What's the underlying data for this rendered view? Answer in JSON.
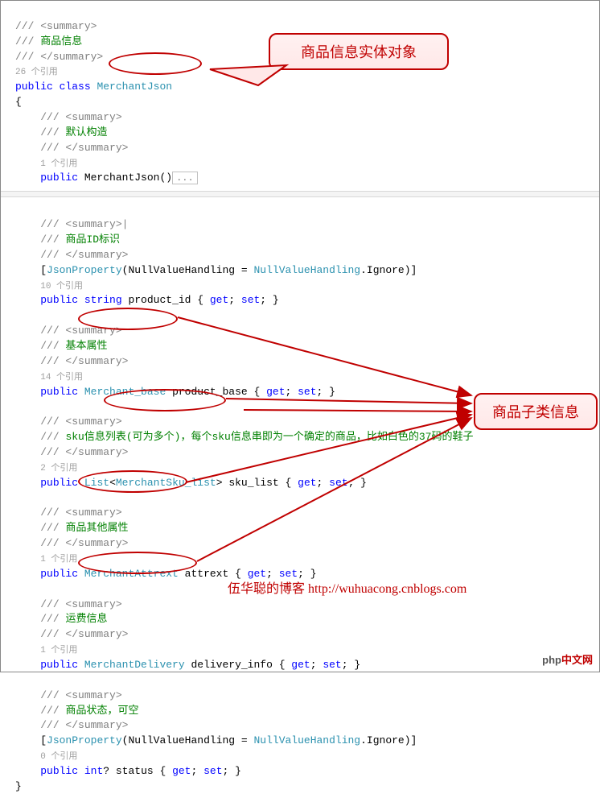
{
  "lines": {
    "l0": "/// <summary>",
    "l1": "/// 商品信息",
    "l2": "/// </summary>",
    "l3": "26 个引用",
    "l4_kw1": "public",
    "l4_kw2": "class",
    "l4_type": "MerchantJson",
    "l5": "{",
    "l6a": "/// <summary>",
    "l6b": "/// 默认构造",
    "l6c": "/// </summary>",
    "l6d": "1 个引用",
    "l7_kw": "public",
    "l7_name": " MerchantJson()",
    "l7_collapse": "...",
    "l8a": "/// <summary>|",
    "l8b": "/// 商品ID标识",
    "l8c": "/// </summary>",
    "l9a": "[",
    "l9b": "JsonProperty",
    "l9c": "(NullValueHandling = ",
    "l9d": "NullValueHandling",
    "l9e": ".Ignore)]",
    "l10": "10 个引用",
    "l11_kw1": "public",
    "l11_kw2": "string",
    "l11_name": " product_id { ",
    "l11_g": "get",
    "l11_s": "set",
    "l11_semi": "; ",
    "l11_end": "; }",
    "l12a": "/// <summary>",
    "l12b": "/// 基本属性",
    "l12c": "/// </summary>",
    "l13": "14 个引用",
    "l14_kw": "public",
    "l14_type": "Merchant_base",
    "l14_rest": " product_base { ",
    "l14_g": "get",
    "l14_s": "set",
    "l15a": "/// <summary>",
    "l15b": "/// sku信息列表(可为多个)，每个sku信息串即为一个确定的商品，比如白色的37码的鞋子",
    "l15c": "/// </summary>",
    "l16": "2 个引用",
    "l17_kw": "public",
    "l17_list": "List",
    "l17_lt": "<",
    "l17_type": "MerchantSku_list",
    "l17_gt": ">",
    "l17_rest": " sku_list { ",
    "l17_g": "get",
    "l17_s": "set",
    "l18a": "/// <summary>",
    "l18b": "/// 商品其他属性",
    "l18c": "/// </summary>",
    "l19": "1 个引用",
    "l20_kw": "public",
    "l20_type": "MerchantAttrext",
    "l20_rest": " attrext { ",
    "l20_g": "get",
    "l20_s": "set",
    "l21a": "/// <summary>",
    "l21b": "/// 运费信息",
    "l21c": "/// </summary>",
    "l22": "1 个引用",
    "l23_kw": "public",
    "l23_type": "MerchantDelivery",
    "l23_rest": " delivery_info { ",
    "l23_g": "get",
    "l23_s": "set",
    "l24a": "/// <summary>",
    "l24b": "/// 商品状态，可空",
    "l24c": "/// </summary>",
    "l25a": "[",
    "l25b": "JsonProperty",
    "l25c": "(NullValueHandling = ",
    "l25d": "NullValueHandling",
    "l25e": ".Ignore)]",
    "l26": "0 个引用",
    "l27_kw1": "public",
    "l27_kw2": "int",
    "l27_q": "?",
    "l27_rest": " status { ",
    "l27_g": "get",
    "l27_s": "set",
    "l28": "}"
  },
  "callouts": {
    "c1": "商品信息实体对象",
    "c2": "商品子类信息"
  },
  "watermark": "伍华聪的博客 http://wuhuacong.cnblogs.com",
  "logo": {
    "php": "php",
    "cn": "中文网"
  }
}
